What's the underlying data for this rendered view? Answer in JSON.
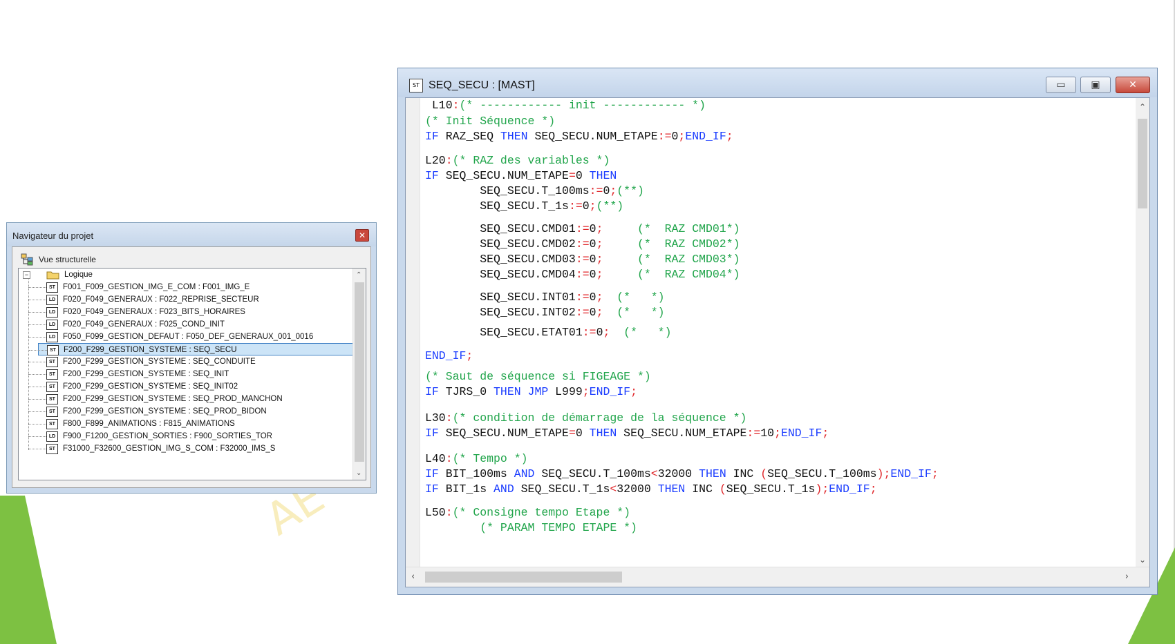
{
  "navigator": {
    "title": "Navigateur du projet",
    "close_label": "✕",
    "view_label": "Vue structurelle",
    "root_label": "Logique",
    "items": [
      {
        "tag": "ST",
        "label": "F001_F009_GESTION_IMG_E_COM : F001_IMG_E",
        "selected": false
      },
      {
        "tag": "LD",
        "label": "F020_F049_GENERAUX : F022_REPRISE_SECTEUR",
        "selected": false
      },
      {
        "tag": "LD",
        "label": "F020_F049_GENERAUX : F023_BITS_HORAIRES",
        "selected": false
      },
      {
        "tag": "LD",
        "label": "F020_F049_GENERAUX : F025_COND_INIT",
        "selected": false
      },
      {
        "tag": "LD",
        "label": "F050_F099_GESTION_DEFAUT : F050_DEF_GENERAUX_001_0016",
        "selected": false
      },
      {
        "tag": "ST",
        "label": "F200_F299_GESTION_SYSTEME : SEQ_SECU",
        "selected": true
      },
      {
        "tag": "ST",
        "label": "F200_F299_GESTION_SYSTEME : SEQ_CONDUITE",
        "selected": false
      },
      {
        "tag": "ST",
        "label": "F200_F299_GESTION_SYSTEME : SEQ_INIT",
        "selected": false
      },
      {
        "tag": "ST",
        "label": "F200_F299_GESTION_SYSTEME : SEQ_INIT02",
        "selected": false
      },
      {
        "tag": "ST",
        "label": "F200_F299_GESTION_SYSTEME : SEQ_PROD_MANCHON",
        "selected": false
      },
      {
        "tag": "ST",
        "label": "F200_F299_GESTION_SYSTEME : SEQ_PROD_BIDON",
        "selected": false
      },
      {
        "tag": "ST",
        "label": "F800_F899_ANIMATIONS : F815_ANIMATIONS",
        "selected": false
      },
      {
        "tag": "LD",
        "label": "F900_F1200_GESTION_SORTIES : F900_SORTIES_TOR",
        "selected": false
      },
      {
        "tag": "ST",
        "label": "F31000_F32600_GESTION_IMG_S_COM : F32000_IMS_S",
        "selected": false
      }
    ]
  },
  "editor": {
    "title": "SEQ_SECU : [MAST]",
    "icon_label": "ST",
    "buttons": {
      "minimize": "▭",
      "maximize": "▣",
      "close": "✕"
    },
    "lines": [
      [
        {
          "t": " L10",
          "c": "v"
        },
        {
          "t": ":",
          "c": "o"
        },
        {
          "t": "(* ------------ init ------------ *)",
          "c": "c"
        }
      ],
      [
        {
          "t": "(* Init Séquence *)",
          "c": "c"
        }
      ],
      [
        {
          "t": "IF",
          "c": "k"
        },
        {
          "t": " RAZ_SEQ ",
          "c": "v"
        },
        {
          "t": "THEN",
          "c": "k"
        },
        {
          "t": " SEQ_SECU.NUM_ETAPE",
          "c": "v"
        },
        {
          "t": ":=",
          "c": "o"
        },
        {
          "t": "0",
          "c": "v"
        },
        {
          "t": ";",
          "c": "o"
        },
        {
          "t": "END_IF",
          "c": "k"
        },
        {
          "t": ";",
          "c": "o"
        }
      ],
      [
        {
          "t": "L20",
          "c": "v"
        },
        {
          "t": ":",
          "c": "o"
        },
        {
          "t": "(* RAZ des variables *)",
          "c": "c"
        }
      ],
      [
        {
          "t": "IF",
          "c": "k"
        },
        {
          "t": " SEQ_SECU.NUM_ETAPE",
          "c": "v"
        },
        {
          "t": "=",
          "c": "o"
        },
        {
          "t": "0 ",
          "c": "v"
        },
        {
          "t": "THEN",
          "c": "k"
        }
      ],
      [
        {
          "t": "        SEQ_SECU.T_100ms",
          "c": "v"
        },
        {
          "t": ":=",
          "c": "o"
        },
        {
          "t": "0",
          "c": "v"
        },
        {
          "t": ";",
          "c": "o"
        },
        {
          "t": "(**)",
          "c": "c"
        }
      ],
      [
        {
          "t": "        SEQ_SECU.T_1s",
          "c": "v"
        },
        {
          "t": ":=",
          "c": "o"
        },
        {
          "t": "0",
          "c": "v"
        },
        {
          "t": ";",
          "c": "o"
        },
        {
          "t": "(**)",
          "c": "c"
        }
      ],
      [
        {
          "t": "        SEQ_SECU.CMD01",
          "c": "v"
        },
        {
          "t": ":=",
          "c": "o"
        },
        {
          "t": "0",
          "c": "v"
        },
        {
          "t": ";",
          "c": "o"
        },
        {
          "t": "     (*  RAZ CMD01*)",
          "c": "c"
        }
      ],
      [
        {
          "t": "        SEQ_SECU.CMD02",
          "c": "v"
        },
        {
          "t": ":=",
          "c": "o"
        },
        {
          "t": "0",
          "c": "v"
        },
        {
          "t": ";",
          "c": "o"
        },
        {
          "t": "     (*  RAZ CMD02*)",
          "c": "c"
        }
      ],
      [
        {
          "t": "        SEQ_SECU.CMD03",
          "c": "v"
        },
        {
          "t": ":=",
          "c": "o"
        },
        {
          "t": "0",
          "c": "v"
        },
        {
          "t": ";",
          "c": "o"
        },
        {
          "t": "     (*  RAZ CMD03*)",
          "c": "c"
        }
      ],
      [
        {
          "t": "        SEQ_SECU.CMD04",
          "c": "v"
        },
        {
          "t": ":=",
          "c": "o"
        },
        {
          "t": "0",
          "c": "v"
        },
        {
          "t": ";",
          "c": "o"
        },
        {
          "t": "     (*  RAZ CMD04*)",
          "c": "c"
        }
      ],
      [
        {
          "t": "        SEQ_SECU.INT01",
          "c": "v"
        },
        {
          "t": ":=",
          "c": "o"
        },
        {
          "t": "0",
          "c": "v"
        },
        {
          "t": ";",
          "c": "o"
        },
        {
          "t": "  (*   *)",
          "c": "c"
        }
      ],
      [
        {
          "t": "        SEQ_SECU.INT02",
          "c": "v"
        },
        {
          "t": ":=",
          "c": "o"
        },
        {
          "t": "0",
          "c": "v"
        },
        {
          "t": ";",
          "c": "o"
        },
        {
          "t": "  (*   *)",
          "c": "c"
        }
      ],
      [
        {
          "t": "        SEQ_SECU.ETAT01",
          "c": "v"
        },
        {
          "t": ":=",
          "c": "o"
        },
        {
          "t": "0",
          "c": "v"
        },
        {
          "t": ";",
          "c": "o"
        },
        {
          "t": "  (*   *)",
          "c": "c"
        }
      ],
      [
        {
          "t": "END_IF",
          "c": "k"
        },
        {
          "t": ";",
          "c": "o"
        }
      ],
      [
        {
          "t": "(* Saut de séquence si FIGEAGE *)",
          "c": "c"
        }
      ],
      [
        {
          "t": "IF",
          "c": "k"
        },
        {
          "t": " TJRS_0 ",
          "c": "v"
        },
        {
          "t": "THEN JMP",
          "c": "k"
        },
        {
          "t": " L999",
          "c": "v"
        },
        {
          "t": ";",
          "c": "o"
        },
        {
          "t": "END_IF",
          "c": "k"
        },
        {
          "t": ";",
          "c": "o"
        }
      ],
      [
        {
          "t": "L30",
          "c": "v"
        },
        {
          "t": ":",
          "c": "o"
        },
        {
          "t": "(* condition de démarrage de la séquence *)",
          "c": "c"
        }
      ],
      [
        {
          "t": "IF",
          "c": "k"
        },
        {
          "t": " SEQ_SECU.NUM_ETAPE",
          "c": "v"
        },
        {
          "t": "=",
          "c": "o"
        },
        {
          "t": "0 ",
          "c": "v"
        },
        {
          "t": "THEN",
          "c": "k"
        },
        {
          "t": " SEQ_SECU.NUM_ETAPE",
          "c": "v"
        },
        {
          "t": ":=",
          "c": "o"
        },
        {
          "t": "10",
          "c": "v"
        },
        {
          "t": ";",
          "c": "o"
        },
        {
          "t": "END_IF",
          "c": "k"
        },
        {
          "t": ";",
          "c": "o"
        }
      ],
      [
        {
          "t": "L40",
          "c": "v"
        },
        {
          "t": ":",
          "c": "o"
        },
        {
          "t": "(* Tempo *)",
          "c": "c"
        }
      ],
      [
        {
          "t": "IF",
          "c": "k"
        },
        {
          "t": " BIT_100ms ",
          "c": "v"
        },
        {
          "t": "AND",
          "c": "k"
        },
        {
          "t": " SEQ_SECU.T_100ms",
          "c": "v"
        },
        {
          "t": "<",
          "c": "o"
        },
        {
          "t": "32000 ",
          "c": "v"
        },
        {
          "t": "THEN",
          "c": "k"
        },
        {
          "t": " INC ",
          "c": "v"
        },
        {
          "t": "(",
          "c": "o"
        },
        {
          "t": "SEQ_SECU.T_100ms",
          "c": "v"
        },
        {
          "t": ");",
          "c": "o"
        },
        {
          "t": "END_IF",
          "c": "k"
        },
        {
          "t": ";",
          "c": "o"
        }
      ],
      [
        {
          "t": "IF",
          "c": "k"
        },
        {
          "t": " BIT_1s ",
          "c": "v"
        },
        {
          "t": "AND",
          "c": "k"
        },
        {
          "t": " SEQ_SECU.T_1s",
          "c": "v"
        },
        {
          "t": "<",
          "c": "o"
        },
        {
          "t": "32000 ",
          "c": "v"
        },
        {
          "t": "THEN",
          "c": "k"
        },
        {
          "t": " INC ",
          "c": "v"
        },
        {
          "t": "(",
          "c": "o"
        },
        {
          "t": "SEQ_SECU.T_1s",
          "c": "v"
        },
        {
          "t": ");",
          "c": "o"
        },
        {
          "t": "END_IF",
          "c": "k"
        },
        {
          "t": ";",
          "c": "o"
        }
      ],
      [
        {
          "t": "L50",
          "c": "v"
        },
        {
          "t": ":",
          "c": "o"
        },
        {
          "t": "(* Consigne tempo Etape *)",
          "c": "c"
        }
      ],
      [
        {
          "t": "        (* PARAM TEMPO ETAPE *)",
          "c": "c"
        }
      ]
    ]
  },
  "watermark": "AE"
}
